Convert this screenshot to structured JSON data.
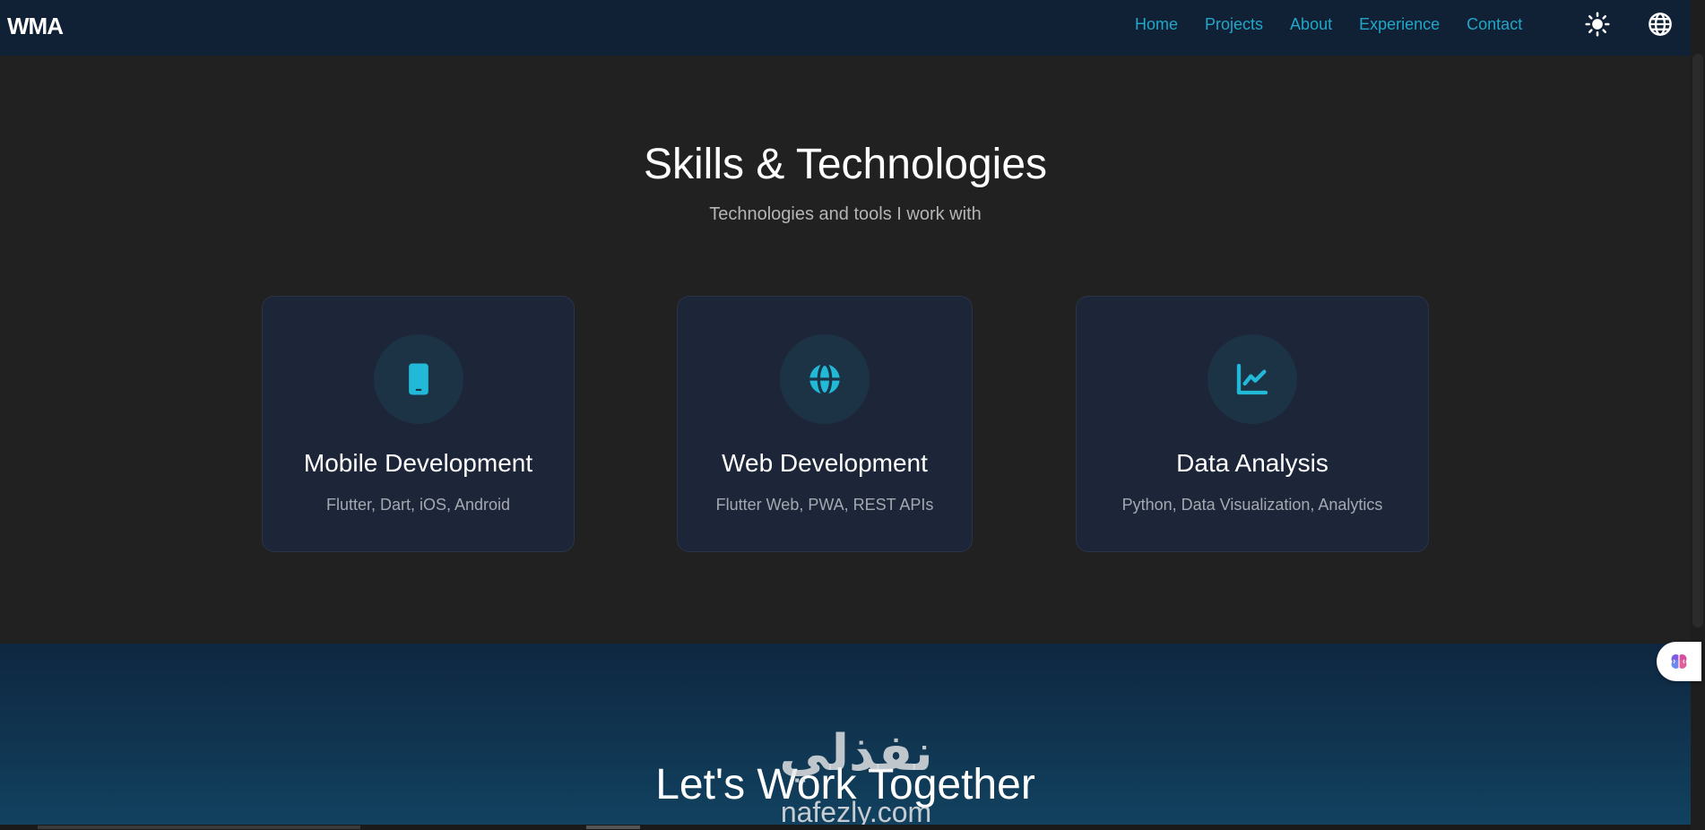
{
  "navbar": {
    "brand": "WMA",
    "links": [
      {
        "label": "Home"
      },
      {
        "label": "Projects"
      },
      {
        "label": "About"
      },
      {
        "label": "Experience"
      },
      {
        "label": "Contact"
      }
    ],
    "theme_icon": "sun-icon",
    "language_icon": "globe-icon",
    "link_color": "#22a7c9",
    "background": "#102035"
  },
  "skills": {
    "title": "Skills & Technologies",
    "subtitle": "Technologies and tools I work with",
    "cards": [
      {
        "icon": "smartphone-icon",
        "title": "Mobile Development",
        "description": "Flutter, Dart, iOS, Android"
      },
      {
        "icon": "globe-icon",
        "title": "Web Development",
        "description": "Flutter Web, PWA, REST APIs"
      },
      {
        "icon": "chart-line-icon",
        "title": "Data Analysis",
        "description": "Python, Data Visualization, Analytics"
      }
    ],
    "accent_color": "#22b8d8"
  },
  "cta": {
    "title": "Let's Work Together"
  },
  "watermark": {
    "arabic": "نفذلي",
    "latin": "nafezly.com"
  },
  "assistant": {
    "icon": "brain-icon"
  }
}
